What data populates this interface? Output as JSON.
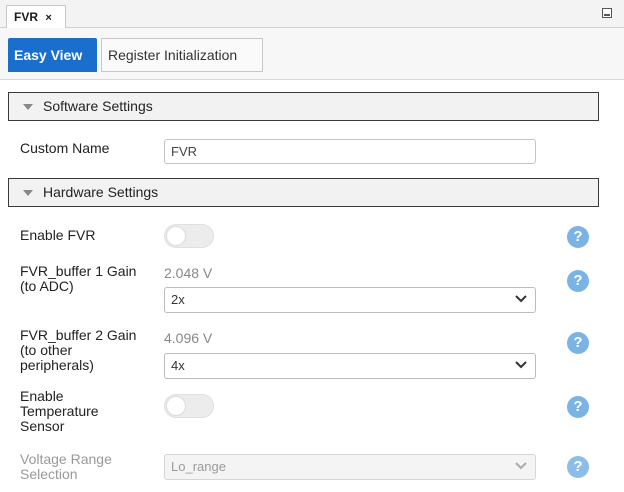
{
  "doc_tab": {
    "label": "FVR",
    "close": "×"
  },
  "view_tabs": [
    {
      "label": "Easy View",
      "active": true
    },
    {
      "label": "Register Initialization",
      "active": false
    }
  ],
  "software_settings": {
    "header": "Software Settings",
    "custom_name": {
      "label": "Custom Name",
      "value": "FVR"
    }
  },
  "hardware_settings": {
    "header": "Hardware Settings",
    "enable_fvr": {
      "label": "Enable FVR",
      "enabled": false
    },
    "buffer1": {
      "label_line1": "FVR_buffer 1 Gain",
      "label_line2": "(to ADC)",
      "voltage": "2.048 V",
      "selected": "2x"
    },
    "buffer2": {
      "label_line1": "FVR_buffer 2 Gain",
      "label_line2": "(to other",
      "label_line3": "peripherals)",
      "voltage": "4.096 V",
      "selected": "4x"
    },
    "temp_sensor": {
      "label_line1": "Enable",
      "label_line2": "Temperature",
      "label_line3": "Sensor",
      "enabled": false
    },
    "voltage_range": {
      "label_line1": "Voltage Range",
      "label_line2": "Selection",
      "selected": "Lo_range",
      "disabled": true
    }
  },
  "help_glyph": "?",
  "colors": {
    "accent": "#1b6fcc",
    "help": "#7bb3e6"
  }
}
